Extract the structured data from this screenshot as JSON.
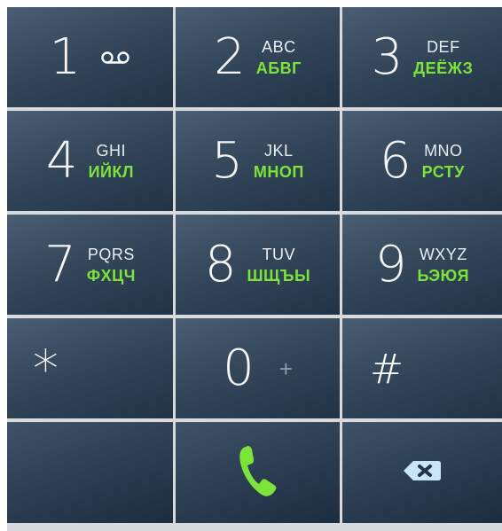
{
  "keys": [
    {
      "digit": "1",
      "letters": "",
      "cyr": "",
      "icon": "voicemail-icon"
    },
    {
      "digit": "2",
      "letters": "ABC",
      "cyr": "АБВГ"
    },
    {
      "digit": "3",
      "letters": "DEF",
      "cyr": "ДЕЁЖЗ"
    },
    {
      "digit": "4",
      "letters": "GHI",
      "cyr": "ИЙКЛ"
    },
    {
      "digit": "5",
      "letters": "JKL",
      "cyr": "МНОП"
    },
    {
      "digit": "6",
      "letters": "MNO",
      "cyr": "РСТУ"
    },
    {
      "digit": "7",
      "letters": "PQRS",
      "cyr": "ФХЦЧ"
    },
    {
      "digit": "8",
      "letters": "TUV",
      "cyr": "ШЩЪЫ"
    },
    {
      "digit": "9",
      "letters": "WXYZ",
      "cyr": "ЬЭЮЯ"
    },
    {
      "symbol": "*"
    },
    {
      "digit": "0",
      "plus": "+"
    },
    {
      "symbol": "#"
    }
  ],
  "actions": {
    "call_icon": "phone-call-icon",
    "backspace_icon": "backspace-icon"
  },
  "colors": {
    "key_bg": "#34475b",
    "grid_bg": "#d8dadd",
    "accent_green": "#7ce33a",
    "digit_white": "#ffffff"
  }
}
